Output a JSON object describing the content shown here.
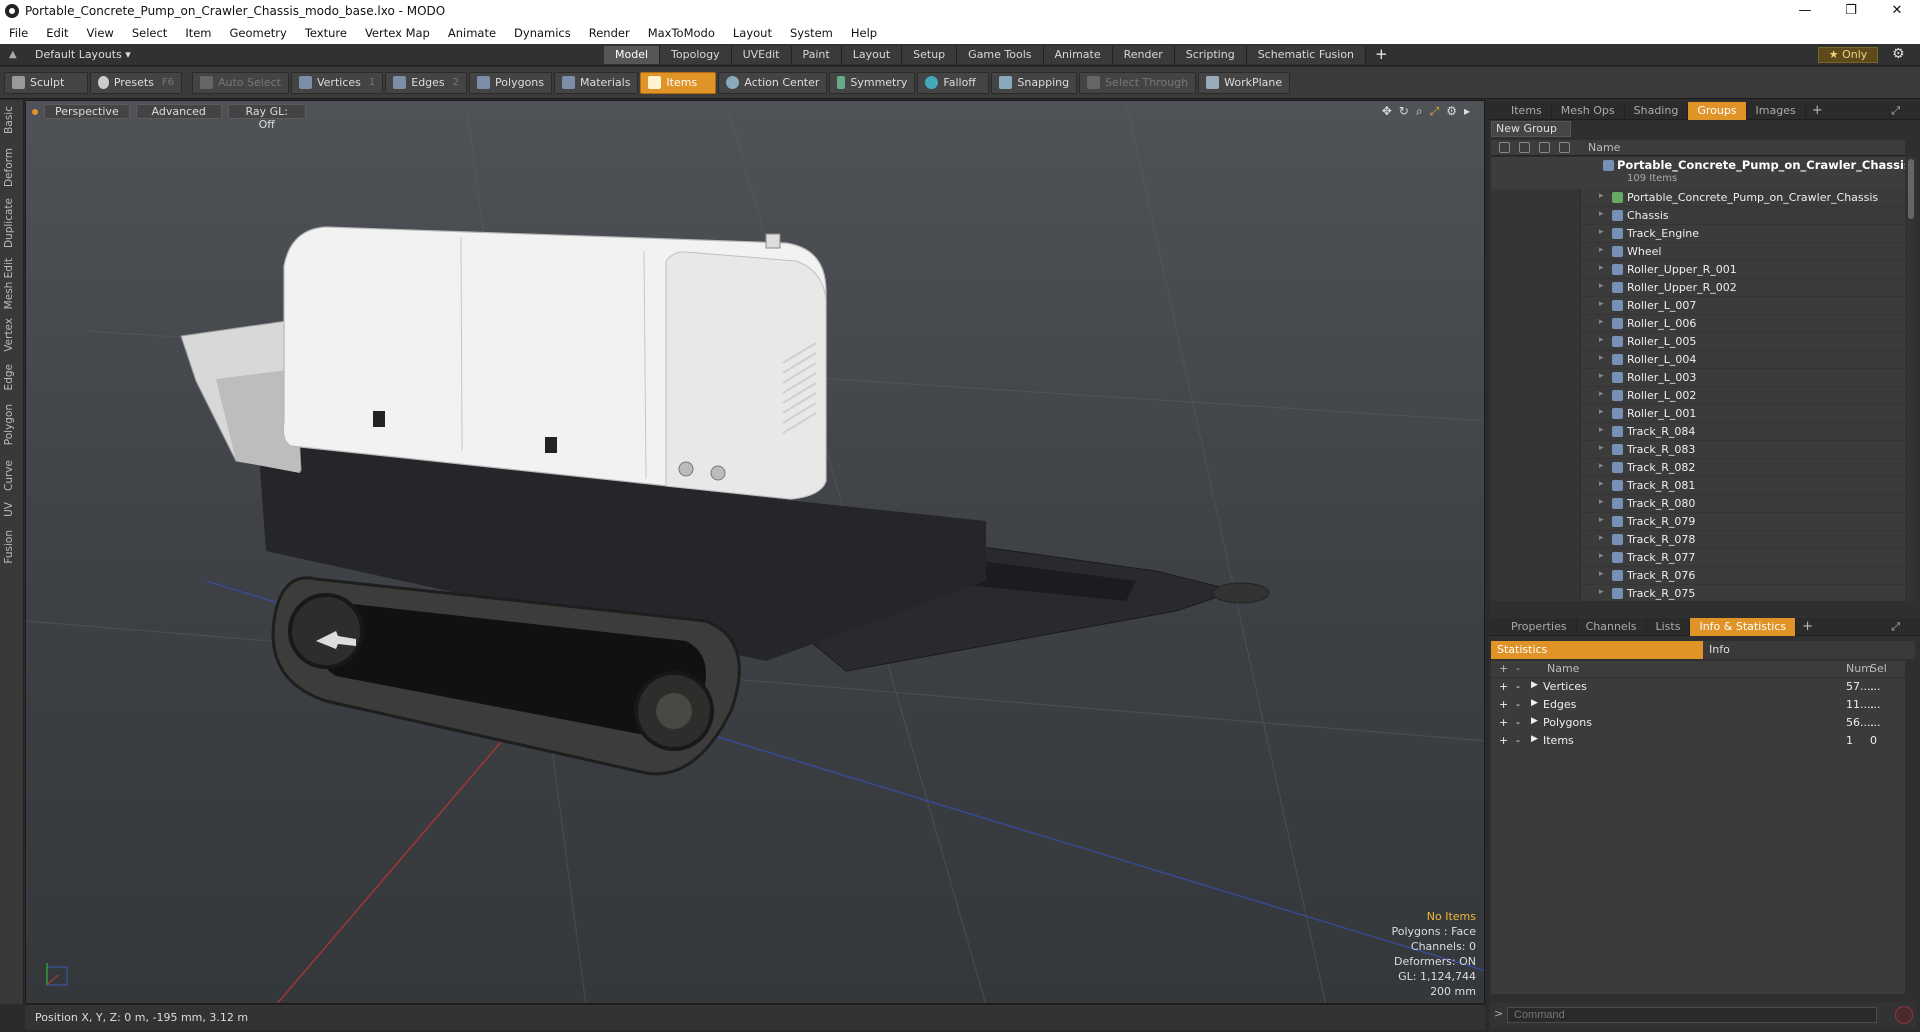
{
  "window": {
    "title": "Portable_Concrete_Pump_on_Crawler_Chassis_modo_base.lxo - MODO",
    "buttons": [
      "—",
      "❐",
      "✕"
    ]
  },
  "menu": [
    "File",
    "Edit",
    "View",
    "Select",
    "Item",
    "Geometry",
    "Texture",
    "Vertex Map",
    "Animate",
    "Dynamics",
    "Render",
    "MaxToModo",
    "Layout",
    "System",
    "Help"
  ],
  "layoutbar": {
    "layout_name": "Default Layouts ▾",
    "tabs": [
      "Model",
      "Topology",
      "UVEdit",
      "Paint",
      "Layout",
      "Setup",
      "Game Tools",
      "Animate",
      "Render",
      "Scripting",
      "Schematic Fusion"
    ],
    "active_tab": "Model",
    "add": "+",
    "only_label": "★  Only"
  },
  "toolbar": {
    "sculpt": "Sculpt",
    "presets": "Presets",
    "presets_key": "F6",
    "auto_select": "Auto Select",
    "vertices": "Vertices",
    "vertices_num": "1",
    "edges": "Edges",
    "edges_num": "2",
    "polygons": "Polygons",
    "materials": "Materials",
    "items": "Items",
    "action_center": "Action Center",
    "symmetry": "Symmetry",
    "falloff": "Falloff",
    "snapping": "Snapping",
    "select_through": "Select Through",
    "workplane": "WorkPlane"
  },
  "left_tabs": [
    "Basic",
    "Deform",
    "Duplicate",
    "Mesh Edit",
    "Vertex",
    "Edge",
    "Polygon",
    "Curve",
    "UV",
    "Fusion"
  ],
  "viewport": {
    "perspective": "Perspective",
    "advanced": "Advanced",
    "raygl": "Ray GL: Off",
    "info": {
      "no_items": "No Items",
      "polygons": "Polygons : Face",
      "channels": "Channels: 0",
      "deformers": "Deformers: ON",
      "gl": "GL: 1,124,744",
      "scale": "200 mm"
    }
  },
  "status": {
    "position": "Position X, Y, Z:   0 m, -195 mm, 3.12 m"
  },
  "groups_panel": {
    "tabs": [
      "Items",
      "Mesh Ops",
      "Shading",
      "Groups",
      "Images"
    ],
    "active_tab": "Groups",
    "new_group": "New Group",
    "col_name": "Name",
    "root_name": "Portable_Concrete_Pump_on_Crawler_Chassis",
    "root_sub": "109 Items",
    "items": [
      "Portable_Concrete_Pump_on_Crawler_Chassis",
      "Chassis",
      "Track_Engine",
      "Wheel",
      "Roller_Upper_R_001",
      "Roller_Upper_R_002",
      "Roller_L_007",
      "Roller_L_006",
      "Roller_L_005",
      "Roller_L_004",
      "Roller_L_003",
      "Roller_L_002",
      "Roller_L_001",
      "Track_R_084",
      "Track_R_083",
      "Track_R_082",
      "Track_R_081",
      "Track_R_080",
      "Track_R_079",
      "Track_R_078",
      "Track_R_077",
      "Track_R_076",
      "Track_R_075"
    ]
  },
  "stats_panel": {
    "tabs": [
      "Properties",
      "Channels",
      "Lists",
      "Info & Statistics"
    ],
    "active_tab": "Info & Statistics",
    "subtabs": [
      "Statistics",
      "Info"
    ],
    "col_name": "Name",
    "col_num": "Num",
    "col_sel": "Sel",
    "rows": [
      {
        "name": "Vertices",
        "num": "57....",
        "sel": "..."
      },
      {
        "name": "Edges",
        "num": "11....",
        "sel": "..."
      },
      {
        "name": "Polygons",
        "num": "56....",
        "sel": "..."
      },
      {
        "name": "Items",
        "num": "1",
        "sel": "0"
      }
    ]
  },
  "command": {
    "placeholder": "Command"
  }
}
